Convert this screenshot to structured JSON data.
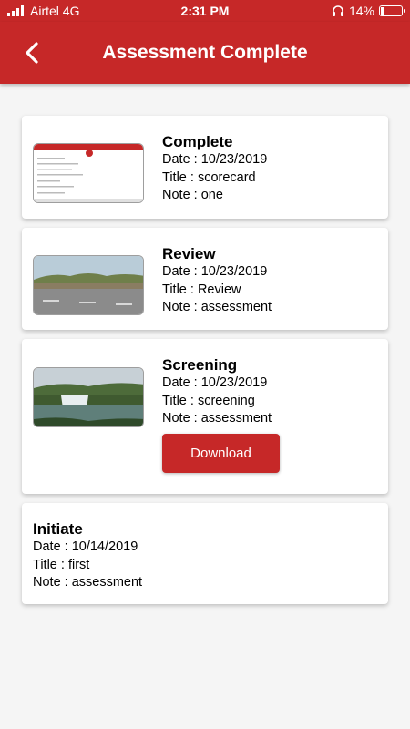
{
  "status_bar": {
    "carrier": "Airtel 4G",
    "time": "2:31 PM",
    "battery": "14%",
    "battery_level": 0.14
  },
  "header": {
    "title": "Assessment Complete",
    "back_icon": "chevron-left-icon"
  },
  "colors": {
    "brand": "#c62828",
    "background": "#f5f5f5",
    "card": "#ffffff"
  },
  "cards": [
    {
      "title": "Complete",
      "date": "Date : 10/23/2019",
      "doc_title": "Title : scorecard",
      "note": "Note : one",
      "thumbnail": "scorecard-document"
    },
    {
      "title": "Review",
      "date": "Date : 10/23/2019",
      "doc_title": "Title : Review",
      "note": "Note : assessment",
      "thumbnail": "road-photo"
    },
    {
      "title": "Screening",
      "date": "Date : 10/23/2019",
      "doc_title": "Title : screening",
      "note": "Note : assessment",
      "thumbnail": "waterfall-photo",
      "button": "Download"
    },
    {
      "title": "Initiate",
      "date": "Date : 10/14/2019",
      "doc_title": "Title : first",
      "note": "Note : assessment"
    }
  ]
}
